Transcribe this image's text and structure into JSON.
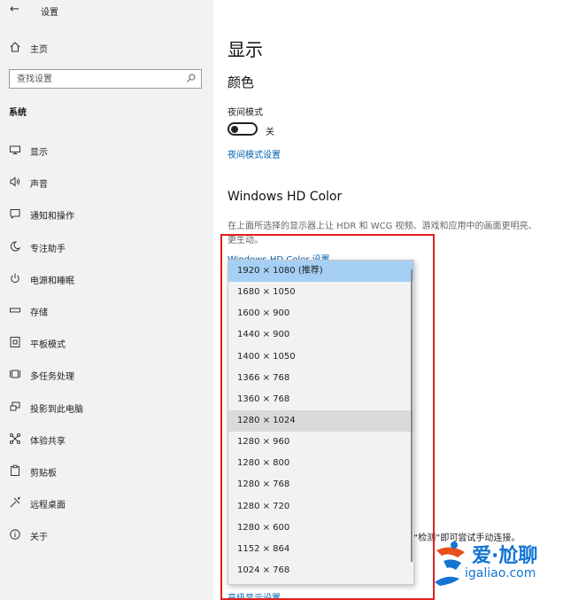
{
  "window": {
    "title": "设置",
    "back_icon": "back-arrow-icon"
  },
  "sidebar": {
    "home_label": "主页",
    "search_placeholder": "查找设置",
    "section": "系统",
    "items": [
      {
        "label": "显示",
        "icon": "monitor-icon"
      },
      {
        "label": "声音",
        "icon": "speaker-icon"
      },
      {
        "label": "通知和操作",
        "icon": "notification-icon"
      },
      {
        "label": "专注助手",
        "icon": "moon-icon"
      },
      {
        "label": "电源和睡眠",
        "icon": "power-icon"
      },
      {
        "label": "存储",
        "icon": "storage-icon"
      },
      {
        "label": "平板模式",
        "icon": "tablet-icon"
      },
      {
        "label": "多任务处理",
        "icon": "multitask-icon"
      },
      {
        "label": "投影到此电脑",
        "icon": "project-icon"
      },
      {
        "label": "体验共享",
        "icon": "share-icon"
      },
      {
        "label": "剪贴板",
        "icon": "clipboard-icon"
      },
      {
        "label": "远程桌面",
        "icon": "remote-desktop-icon"
      },
      {
        "label": "关于",
        "icon": "info-icon"
      }
    ]
  },
  "main": {
    "title": "显示",
    "color_heading": "颜色",
    "night_mode_label": "夜间模式",
    "night_mode_state": "关",
    "night_mode_link": "夜间模式设置",
    "hd_heading": "Windows HD Color",
    "hd_description": "在上面所选择的显示器上让 HDR 和 WCG 视频、游戏和应用中的画面更明亮、更生动。",
    "hd_link": "Windows HD Color 设置",
    "connect_hint": "“检测”即可尝试手动连接。",
    "advanced_link": "高级显示设置"
  },
  "resolution_dropdown": {
    "selected": "1920 × 1080 (推荐)",
    "options": [
      "1920 × 1080 (推荐)",
      "1680 × 1050",
      "1600 × 900",
      "1440 × 900",
      "1400 × 1050",
      "1366 × 768",
      "1360 × 768",
      "1280 × 1024",
      "1280 × 960",
      "1280 × 800",
      "1280 × 768",
      "1280 × 720",
      "1280 × 600",
      "1152 × 864",
      "1024 × 768"
    ]
  },
  "watermark": {
    "brand": "爱·尬聊",
    "domain": "igaliao.com"
  },
  "colors": {
    "accent": "#0063b1",
    "annotation": "#e02020",
    "selected": "#a5cff5"
  }
}
